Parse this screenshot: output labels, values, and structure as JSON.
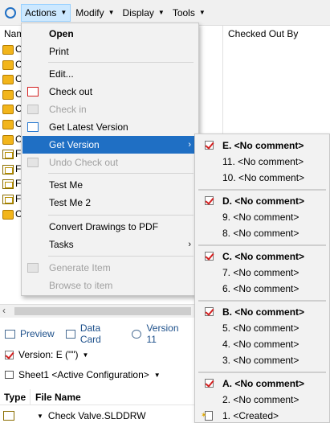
{
  "menubar": {
    "items": [
      {
        "label": "Actions",
        "active": true
      },
      {
        "label": "Modify"
      },
      {
        "label": "Display"
      },
      {
        "label": "Tools"
      }
    ]
  },
  "grid": {
    "name_header_partial": "Nam",
    "checked_out_by_header": "Checked Out By",
    "row_partials": [
      "C",
      "C",
      "C",
      "C",
      "C",
      "C",
      "C",
      "F",
      "F",
      "F",
      "F",
      "C",
      "C"
    ]
  },
  "actions_menu": {
    "items": [
      {
        "label": "Open",
        "bold": true
      },
      {
        "label": "Print"
      },
      {
        "label": "Edit..."
      },
      {
        "label": "Check out",
        "icon": "check-out-icon"
      },
      {
        "label": "Check in",
        "disabled": true,
        "icon": "check-in-icon"
      },
      {
        "label": "Get Latest Version",
        "icon": "get-latest-icon"
      },
      {
        "label": "Get Version",
        "highlighted": true,
        "submenu": true
      },
      {
        "label": "Undo Check out",
        "disabled": true,
        "icon": "undo-checkout-icon"
      },
      {
        "label": "Test Me"
      },
      {
        "label": "Test Me 2"
      },
      {
        "label": "Convert Drawings to PDF"
      },
      {
        "label": "Tasks",
        "submenu": true
      },
      {
        "label": "Generate Item",
        "disabled": true,
        "icon": "generate-item-icon"
      },
      {
        "label": "Browse to item",
        "disabled": true
      }
    ]
  },
  "get_version_menu": {
    "groups": [
      {
        "header": "E. <No comment>",
        "items": [
          "11. <No comment>",
          "10. <No comment>"
        ]
      },
      {
        "header": "D. <No comment>",
        "items": [
          "9. <No comment>",
          "8. <No comment>"
        ]
      },
      {
        "header": "C. <No comment>",
        "items": [
          "7. <No comment>",
          "6. <No comment>"
        ]
      },
      {
        "header": "B. <No comment>",
        "items": [
          "5. <No comment>",
          "4. <No comment>",
          "3. <No comment>"
        ]
      },
      {
        "header": "A. <No comment>",
        "items": [
          "2. <No comment>",
          "1. <Created>"
        ]
      }
    ]
  },
  "bottom_panel": {
    "tabs": [
      "Preview",
      "Data Card",
      "Version 11"
    ],
    "version_label": "Version: E (\"\")",
    "configuration": "Sheet1 <Active Configuration>",
    "table_headers": {
      "type": "Type",
      "file_name": "File Name"
    },
    "file_row": "Check Valve.SLDDRW"
  }
}
